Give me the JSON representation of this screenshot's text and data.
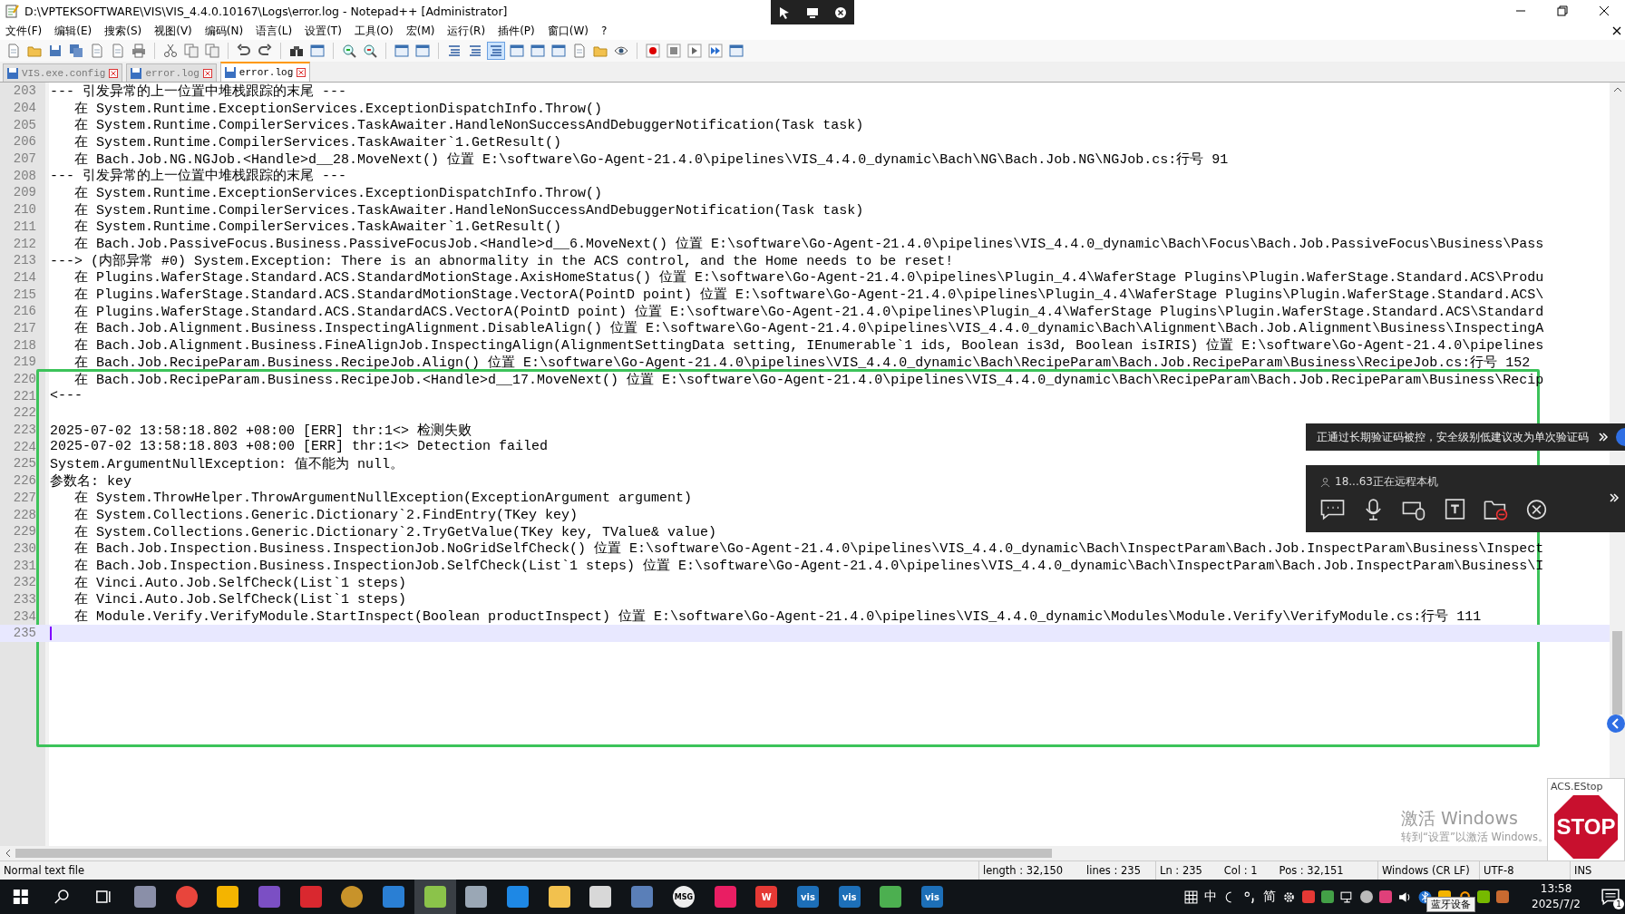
{
  "window": {
    "title": "D:\\VPTEKSOFTWARE\\VIS\\VIS_4.4.0.10167\\Logs\\error.log - Notepad++ [Administrator]"
  },
  "menu": [
    "文件(F)",
    "编辑(E)",
    "搜索(S)",
    "视图(V)",
    "编码(N)",
    "语言(L)",
    "设置(T)",
    "工具(O)",
    "宏(M)",
    "运行(R)",
    "插件(P)",
    "窗口(W)",
    "?"
  ],
  "tabs": [
    {
      "label": "VIS.exe.config",
      "selected": false
    },
    {
      "label": "error.log",
      "selected": false
    },
    {
      "label": "error.log",
      "selected": true
    }
  ],
  "editor": {
    "lines": [
      {
        "number": "203",
        "text": "--- 引发异常的上一位置中堆栈跟踪的末尾 ---",
        "current": false
      },
      {
        "number": "204",
        "text": "   在 System.Runtime.ExceptionServices.ExceptionDispatchInfo.Throw()",
        "current": false
      },
      {
        "number": "205",
        "text": "   在 System.Runtime.CompilerServices.TaskAwaiter.HandleNonSuccessAndDebuggerNotification(Task task)",
        "current": false
      },
      {
        "number": "206",
        "text": "   在 System.Runtime.CompilerServices.TaskAwaiter`1.GetResult()",
        "current": false
      },
      {
        "number": "207",
        "text": "   在 Bach.Job.NG.NGJob.<Handle>d__28.MoveNext() 位置 E:\\software\\Go-Agent-21.4.0\\pipelines\\VIS_4.4.0_dynamic\\Bach\\NG\\Bach.Job.NG\\NGJob.cs:行号 91",
        "current": false
      },
      {
        "number": "208",
        "text": "--- 引发异常的上一位置中堆栈跟踪的末尾 ---",
        "current": false
      },
      {
        "number": "209",
        "text": "   在 System.Runtime.ExceptionServices.ExceptionDispatchInfo.Throw()",
        "current": false
      },
      {
        "number": "210",
        "text": "   在 System.Runtime.CompilerServices.TaskAwaiter.HandleNonSuccessAndDebuggerNotification(Task task)",
        "current": false
      },
      {
        "number": "211",
        "text": "   在 System.Runtime.CompilerServices.TaskAwaiter`1.GetResult()",
        "current": false
      },
      {
        "number": "212",
        "text": "   在 Bach.Job.PassiveFocus.Business.PassiveFocusJob.<Handle>d__6.MoveNext() 位置 E:\\software\\Go-Agent-21.4.0\\pipelines\\VIS_4.4.0_dynamic\\Bach\\Focus\\Bach.Job.PassiveFocus\\Business\\Pass",
        "current": false
      },
      {
        "number": "213",
        "text": "---> (内部异常 #0) System.Exception: There is an abnormality in the ACS control, and the Home needs to be reset!",
        "current": false
      },
      {
        "number": "214",
        "text": "   在 Plugins.WaferStage.Standard.ACS.StandardMotionStage.AxisHomeStatus() 位置 E:\\software\\Go-Agent-21.4.0\\pipelines\\Plugin_4.4\\WaferStage Plugins\\Plugin.WaferStage.Standard.ACS\\Produ",
        "current": false
      },
      {
        "number": "215",
        "text": "   在 Plugins.WaferStage.Standard.ACS.StandardMotionStage.VectorA(PointD point) 位置 E:\\software\\Go-Agent-21.4.0\\pipelines\\Plugin_4.4\\WaferStage Plugins\\Plugin.WaferStage.Standard.ACS\\",
        "current": false
      },
      {
        "number": "216",
        "text": "   在 Plugins.WaferStage.Standard.ACS.StandardACS.VectorA(PointD point) 位置 E:\\software\\Go-Agent-21.4.0\\pipelines\\Plugin_4.4\\WaferStage Plugins\\Plugin.WaferStage.Standard.ACS\\Standard",
        "current": false
      },
      {
        "number": "217",
        "text": "   在 Bach.Job.Alignment.Business.InspectingAlignment.DisableAlign() 位置 E:\\software\\Go-Agent-21.4.0\\pipelines\\VIS_4.4.0_dynamic\\Bach\\Alignment\\Bach.Job.Alignment\\Business\\InspectingA",
        "current": false
      },
      {
        "number": "218",
        "text": "   在 Bach.Job.Alignment.Business.FineAlignJob.InspectingAlign(AlignmentSettingData setting, IEnumerable`1 ids, Boolean is3d, Boolean isIRIS) 位置 E:\\software\\Go-Agent-21.4.0\\pipelines",
        "current": false
      },
      {
        "number": "219",
        "text": "   在 Bach.Job.RecipeParam.Business.RecipeJob.Align() 位置 E:\\software\\Go-Agent-21.4.0\\pipelines\\VIS_4.4.0_dynamic\\Bach\\RecipeParam\\Bach.Job.RecipeParam\\Business\\RecipeJob.cs:行号 152",
        "current": false
      },
      {
        "number": "220",
        "text": "   在 Bach.Job.RecipeParam.Business.RecipeJob.<Handle>d__17.MoveNext() 位置 E:\\software\\Go-Agent-21.4.0\\pipelines\\VIS_4.4.0_dynamic\\Bach\\RecipeParam\\Bach.Job.RecipeParam\\Business\\Recip",
        "current": false
      },
      {
        "number": "221",
        "text": "<---",
        "current": false
      },
      {
        "number": "222",
        "current": false
      },
      {
        "number": "223",
        "text": "2025-07-02 13:58:18.802 +08:00 [ERR] thr:1<> 检测失败",
        "current": false
      },
      {
        "number": "224",
        "text": "2025-07-02 13:58:18.803 +08:00 [ERR] thr:1<> Detection failed",
        "current": false
      },
      {
        "number": "225",
        "text": "System.ArgumentNullException: 值不能为 null。",
        "current": false
      },
      {
        "number": "226",
        "text": "参数名: key",
        "current": false
      },
      {
        "number": "227",
        "text": "   在 System.ThrowHelper.ThrowArgumentNullException(ExceptionArgument argument)",
        "current": false
      },
      {
        "number": "228",
        "text": "   在 System.Collections.Generic.Dictionary`2.FindEntry(TKey key)",
        "current": false
      },
      {
        "number": "229",
        "text": "   在 System.Collections.Generic.Dictionary`2.TryGetValue(TKey key, TValue& value)",
        "current": false
      },
      {
        "number": "230",
        "text": "   在 Bach.Job.Inspection.Business.InspectionJob.NoGridSelfCheck() 位置 E:\\software\\Go-Agent-21.4.0\\pipelines\\VIS_4.4.0_dynamic\\Bach\\InspectParam\\Bach.Job.InspectParam\\Business\\Inspect",
        "current": false
      },
      {
        "number": "231",
        "text": "   在 Bach.Job.Inspection.Business.InspectionJob.SelfCheck(List`1 steps) 位置 E:\\software\\Go-Agent-21.4.0\\pipelines\\VIS_4.4.0_dynamic\\Bach\\InspectParam\\Bach.Job.InspectParam\\Business\\I",
        "current": false
      },
      {
        "number": "232",
        "text": "   在 Vinci.Auto.Job.SelfCheck(List`1 steps)",
        "current": false
      },
      {
        "number": "233",
        "text": "   在 Vinci.Auto.Job.SelfCheck(List`1 steps)",
        "current": false
      },
      {
        "number": "234",
        "text": "   在 Module.Verify.VerifyModule.StartInspect(Boolean productInspect) 位置 E:\\software\\Go-Agent-21.4.0\\pipelines\\VIS_4.4.0_dynamic\\Modules\\Module.Verify\\VerifyModule.cs:行号 111",
        "current": false
      },
      {
        "number": "235",
        "current": true
      }
    ]
  },
  "status_bar": {
    "file_type": "Normal text file",
    "length": "length : 32,150",
    "lines": "lines : 235",
    "ln": "Ln : 235",
    "col": "Col : 1",
    "pos": "Pos : 32,151",
    "eol": "Windows (CR LF)",
    "encoding": "UTF-8",
    "mode": "INS"
  },
  "remote_notice": {
    "text": "正通过长期验证码被控，安全级别低建议改为单次验证码"
  },
  "remote_panel": {
    "status": "18...63正在远程本机"
  },
  "estop_window": {
    "title": "ACS.EStop",
    "sign": "STOP"
  },
  "activation_watermark": {
    "title": "激活 Windows",
    "hint": "转到“设置”以激活 Windows。"
  },
  "taskbar": {
    "apps": [
      {
        "kind": "file",
        "selected": false
      },
      {
        "kind": "browser",
        "selected": false
      },
      {
        "kind": "tiles",
        "selected": false
      },
      {
        "kind": "studio",
        "selected": false
      },
      {
        "kind": "redapp",
        "selected": false
      },
      {
        "kind": "globe",
        "selected": false
      },
      {
        "kind": "window",
        "selected": false
      },
      {
        "kind": "notepad",
        "selected": true
      },
      {
        "kind": "monitor",
        "selected": false
      },
      {
        "kind": "arrow",
        "selected": false
      },
      {
        "kind": "folder",
        "selected": false
      },
      {
        "kind": "chart",
        "selected": false
      },
      {
        "kind": "remote",
        "selected": false
      },
      {
        "kind": "msg",
        "label": "MSG",
        "selected": false
      },
      {
        "kind": "puzzle",
        "selected": false
      },
      {
        "kind": "wps",
        "label": "W",
        "selected": false
      },
      {
        "kind": "vis",
        "label": "vis",
        "selected": false
      },
      {
        "kind": "vis",
        "label": "vis",
        "selected": false
      },
      {
        "kind": "lock",
        "selected": false
      },
      {
        "kind": "vis",
        "label": "vis",
        "selected": false
      }
    ],
    "ime": [
      "中",
      "简"
    ],
    "tooltip": "蓝牙设备",
    "time": "13:58",
    "date": "2025/7/2",
    "notifications": "1"
  }
}
